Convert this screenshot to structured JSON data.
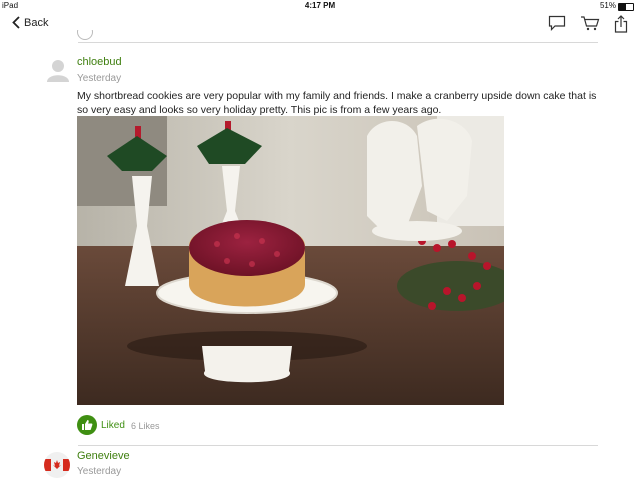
{
  "status_bar": {
    "carrier": "iPad",
    "time": "4:17 PM",
    "battery": "51%",
    "battery_level": 0.51
  },
  "nav": {
    "back_label": "Back",
    "icons": [
      "comment-icon",
      "cart-icon",
      "share-icon"
    ]
  },
  "post": {
    "author": "chloebud",
    "time": "Yesterday",
    "text": "My shortbread cookies are very popular with my family and friends. I make a cranberry upside down cake that is so very easy and looks so very holiday pretty. This pic is from a few years ago.",
    "liked_label": "Liked",
    "likes": "6 Likes"
  },
  "next_post": {
    "author": "Genevieve",
    "time": "Yesterday"
  },
  "colors": {
    "accent": "#3f8f12",
    "username": "#3f7f0f",
    "muted": "#999999"
  }
}
